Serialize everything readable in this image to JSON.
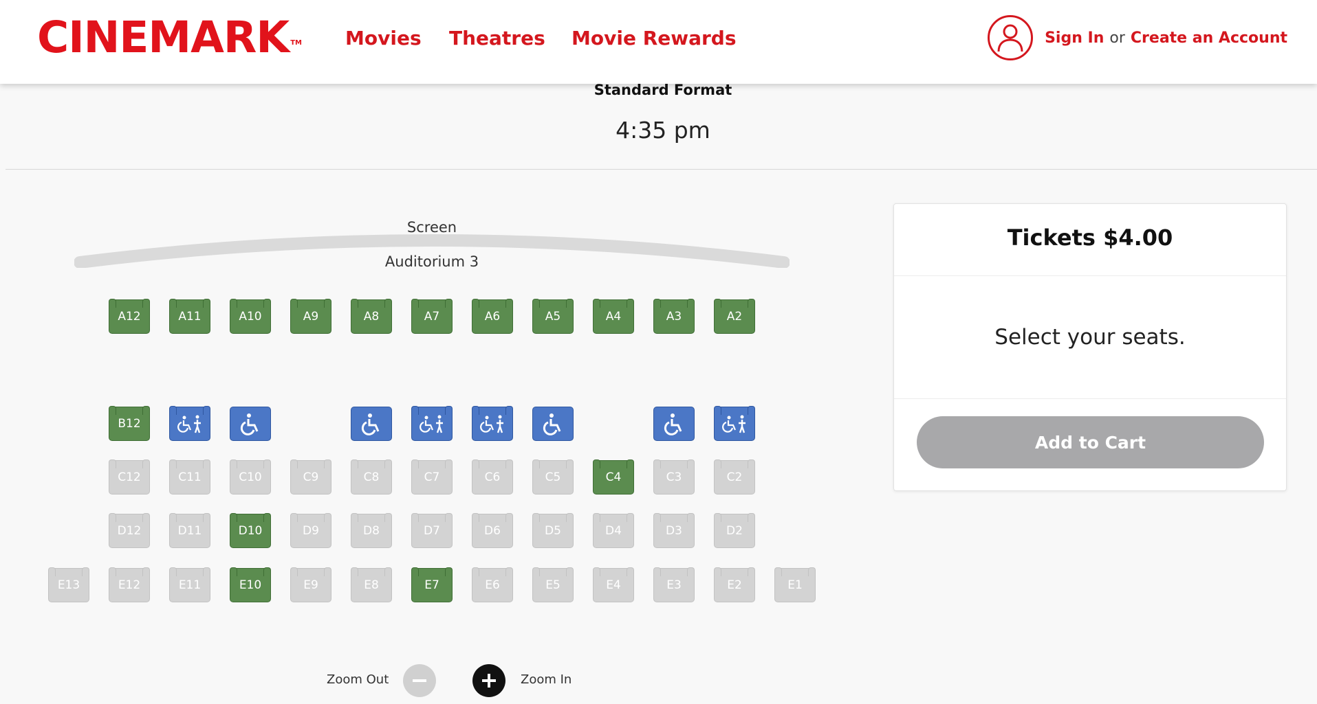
{
  "header": {
    "logo": "CINEMARK",
    "logo_tm": "TM",
    "nav": [
      {
        "label": "Movies"
      },
      {
        "label": "Theatres"
      },
      {
        "label": "Movie Rewards"
      }
    ],
    "sign_in": "Sign In",
    "or": "or",
    "create_account": "Create an Account"
  },
  "showtime": {
    "format": "Standard Format",
    "time": "4:35 pm"
  },
  "seatmap": {
    "screen_label": "Screen",
    "auditorium": "Auditorium 3",
    "rows": [
      {
        "row": "A",
        "seats": [
          {
            "label": "A12",
            "status": "available"
          },
          {
            "label": "A11",
            "status": "available"
          },
          {
            "label": "A10",
            "status": "available"
          },
          {
            "label": "A9",
            "status": "available"
          },
          {
            "label": "A8",
            "status": "available"
          },
          {
            "label": "A7",
            "status": "available"
          },
          {
            "label": "A6",
            "status": "available"
          },
          {
            "label": "A5",
            "status": "available"
          },
          {
            "label": "A4",
            "status": "available"
          },
          {
            "label": "A3",
            "status": "available"
          },
          {
            "label": "A2",
            "status": "available"
          }
        ]
      },
      {
        "row": "B",
        "seats": [
          {
            "label": "B12",
            "status": "available"
          },
          {
            "label": "",
            "status": "companion",
            "icon": "companion-icon"
          },
          {
            "label": "",
            "status": "wheel",
            "icon": "wheelchair-icon"
          },
          null,
          {
            "label": "",
            "status": "wheel",
            "icon": "wheelchair-icon"
          },
          {
            "label": "",
            "status": "companion",
            "icon": "companion-icon"
          },
          {
            "label": "",
            "status": "companion",
            "icon": "companion-icon"
          },
          {
            "label": "",
            "status": "wheel",
            "icon": "wheelchair-icon"
          },
          null,
          {
            "label": "",
            "status": "wheel",
            "icon": "wheelchair-icon"
          },
          {
            "label": "",
            "status": "companion",
            "icon": "companion-icon"
          }
        ]
      },
      {
        "row": "C",
        "seats": [
          {
            "label": "C12",
            "status": "taken"
          },
          {
            "label": "C11",
            "status": "taken"
          },
          {
            "label": "C10",
            "status": "taken"
          },
          {
            "label": "C9",
            "status": "taken"
          },
          {
            "label": "C8",
            "status": "taken"
          },
          {
            "label": "C7",
            "status": "taken"
          },
          {
            "label": "C6",
            "status": "taken"
          },
          {
            "label": "C5",
            "status": "taken"
          },
          {
            "label": "C4",
            "status": "available"
          },
          {
            "label": "C3",
            "status": "taken"
          },
          {
            "label": "C2",
            "status": "taken"
          }
        ]
      },
      {
        "row": "D",
        "seats": [
          {
            "label": "D12",
            "status": "taken"
          },
          {
            "label": "D11",
            "status": "taken"
          },
          {
            "label": "D10",
            "status": "available"
          },
          {
            "label": "D9",
            "status": "taken"
          },
          {
            "label": "D8",
            "status": "taken"
          },
          {
            "label": "D7",
            "status": "taken"
          },
          {
            "label": "D6",
            "status": "taken"
          },
          {
            "label": "D5",
            "status": "taken"
          },
          {
            "label": "D4",
            "status": "taken"
          },
          {
            "label": "D3",
            "status": "taken"
          },
          {
            "label": "D2",
            "status": "taken"
          }
        ]
      },
      {
        "row": "E",
        "seats": [
          {
            "label": "E13",
            "status": "taken"
          },
          {
            "label": "E12",
            "status": "taken"
          },
          {
            "label": "E11",
            "status": "taken"
          },
          {
            "label": "E10",
            "status": "available"
          },
          {
            "label": "E9",
            "status": "taken"
          },
          {
            "label": "E8",
            "status": "taken"
          },
          {
            "label": "E7",
            "status": "available"
          },
          {
            "label": "E6",
            "status": "taken"
          },
          {
            "label": "E5",
            "status": "taken"
          },
          {
            "label": "E4",
            "status": "taken"
          },
          {
            "label": "E3",
            "status": "taken"
          },
          {
            "label": "E2",
            "status": "taken"
          },
          {
            "label": "E1",
            "status": "taken"
          }
        ]
      }
    ],
    "zoom_out": "Zoom Out",
    "zoom_in": "Zoom In"
  },
  "panel": {
    "title": "Tickets $4.00",
    "message": "Select your seats.",
    "add_to_cart": "Add to Cart"
  },
  "colors": {
    "brand_red": "#e1131b",
    "seat_available": "#5b8c4f",
    "seat_taken": "#d3d3d3",
    "seat_accessible": "#4b77c6",
    "button_disabled": "#a8a8aa"
  }
}
